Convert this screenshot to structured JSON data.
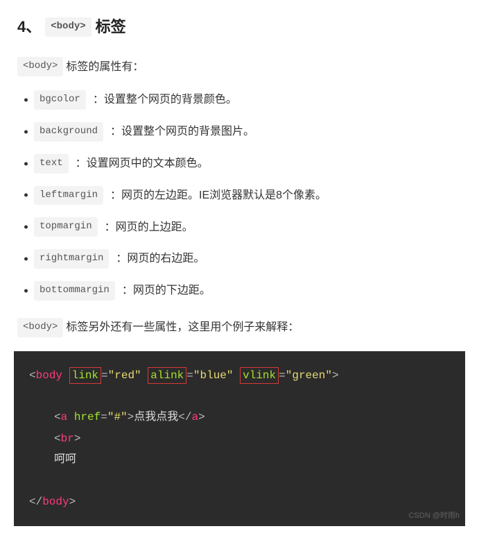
{
  "heading": {
    "number": "4、",
    "code": "<body>",
    "title": "标签"
  },
  "intro": {
    "code": "<body>",
    "text": "标签的属性有："
  },
  "attrs": [
    {
      "code": "bgcolor",
      "desc": "：设置整个网页的背景颜色。"
    },
    {
      "code": "background",
      "desc": "：设置整个网页的背景图片。"
    },
    {
      "code": "text",
      "desc": "：设置网页中的文本颜色。"
    },
    {
      "code": "leftmargin",
      "desc": "：网页的左边距。IE浏览器默认是8个像素。"
    },
    {
      "code": "topmargin",
      "desc": "：网页的上边距。"
    },
    {
      "code": "rightmargin",
      "desc": "：网页的右边距。"
    },
    {
      "code": "bottommargin",
      "desc": "：网页的下边距。"
    }
  ],
  "outro": {
    "code": "<body>",
    "text": "标签另外还有一些属性，这里用个例子来解释："
  },
  "code_example": {
    "body_open": {
      "tag": "body",
      "attrs": [
        {
          "name": "link",
          "val": "\"red\""
        },
        {
          "name": "alink",
          "val": "\"blue\""
        },
        {
          "name": "vlink",
          "val": "\"green\""
        }
      ]
    },
    "a_open": {
      "tag": "a",
      "attr_name": "href",
      "attr_val": "\"#\""
    },
    "a_text": "点我点我",
    "a_close": "a",
    "br_tag": "br",
    "plain_text": "呵呵",
    "body_close": "body"
  },
  "watermark": "CSDN @时雨h"
}
